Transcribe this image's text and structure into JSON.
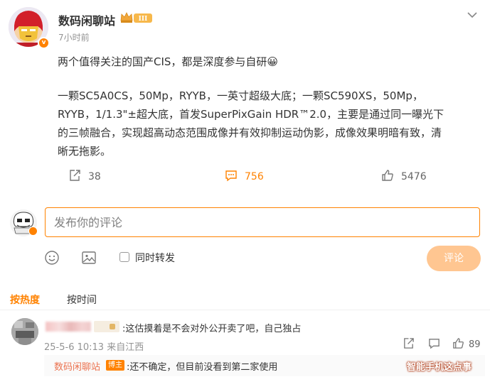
{
  "post": {
    "author": "数码闲聊站",
    "level_badge": "III",
    "verified_mark": "v",
    "time": "7小时前",
    "lead": "两个值得关注的国产CIS，都是深度参与自研",
    "emoji": "😀",
    "line1": "一颗SC5A0CS，50Mp，RYYB，一英寸超级大底；一颗SC590XS，50Mp，",
    "line2": "RYYB，1/1.3\"±超大底，首发SuperPixGain HDR™2.0，主要是通过同一曝光下",
    "line3": "的三帧融合，实现超高动态范围成像并有效抑制运动伪影，成像效果明暗有致，清",
    "line4": "晰无拖影。"
  },
  "actions": {
    "repost_count": "38",
    "comment_count": "756",
    "like_count": "5476"
  },
  "composer": {
    "placeholder": "发布你的评论",
    "repost_label": "同时转发",
    "submit_label": "评论"
  },
  "sort": {
    "hot_label": "按热度",
    "time_label": "按时间"
  },
  "comments": [
    {
      "text": ":这估摸着是不会对外公开卖了吧，自己独占",
      "meta": "25-5-6 10:13 来自江西",
      "like_count": "89",
      "reply": {
        "user": "数码闲聊站",
        "tag": "博主",
        "text": ":还不确定，但目前没看到第二家使用"
      }
    }
  ],
  "watermark": "智能手机这点事",
  "colors": {
    "accent": "#ff8200",
    "submit_disabled": "#ffc691",
    "reply_user": "#eb7350",
    "muted": "#939393"
  }
}
